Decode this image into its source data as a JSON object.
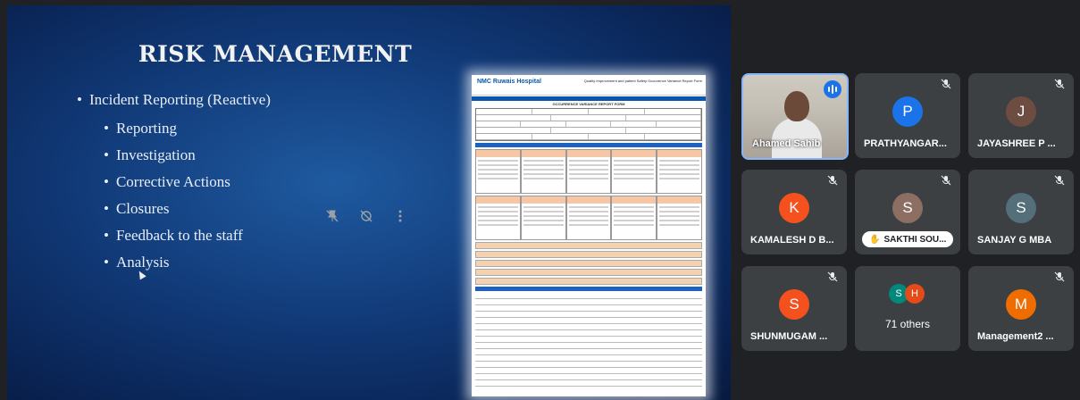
{
  "slide": {
    "title": "RISK MANAGEMENT",
    "main_bullet": "Incident  Reporting (Reactive)",
    "sub_bullets": [
      "Reporting",
      "Investigation",
      "Corrective Actions",
      "Closures",
      "Feedback to the staff",
      "Analysis"
    ],
    "bullet_char": "•",
    "document": {
      "hospital": "NMC Ruwais Hospital",
      "header_right": "Quality Improvement and patient Safety\nOccurrence Variance Report Form",
      "form_title": "OCCURRENCE VARIANCE REPORT FORM"
    }
  },
  "overlay_controls": [
    "pin-off-icon",
    "hide-icon",
    "more-vert-icon"
  ],
  "participants": [
    {
      "name": "Ahamed Sahib",
      "type": "video",
      "speaking": true
    },
    {
      "name": "PRATHYANGAR...",
      "initial": "P",
      "color": "#1a73e8",
      "muted": true
    },
    {
      "name": "JAYASHREE P ...",
      "initial": "J",
      "color": "#6d4c41",
      "muted": true
    },
    {
      "name": "KAMALESH D B...",
      "initial": "K",
      "color": "#f4511e",
      "muted": true
    },
    {
      "name": "SAKTHI SOU...",
      "initial": "S",
      "color": "#8d6e63",
      "muted": true,
      "pinned_label": true
    },
    {
      "name": "SANJAY G MBA",
      "initial": "S",
      "color": "#546e7a",
      "muted": true
    },
    {
      "name": "SHUNMUGAM ...",
      "initial": "S",
      "color": "#f4511e",
      "muted": true
    },
    {
      "name": "71 others",
      "minis": [
        {
          "initial": "S",
          "color": "#00897b"
        },
        {
          "initial": "H",
          "color": "#e64a19"
        }
      ]
    },
    {
      "name": "Management2 ...",
      "initial": "M",
      "color": "#ef6c00",
      "muted": true
    }
  ]
}
